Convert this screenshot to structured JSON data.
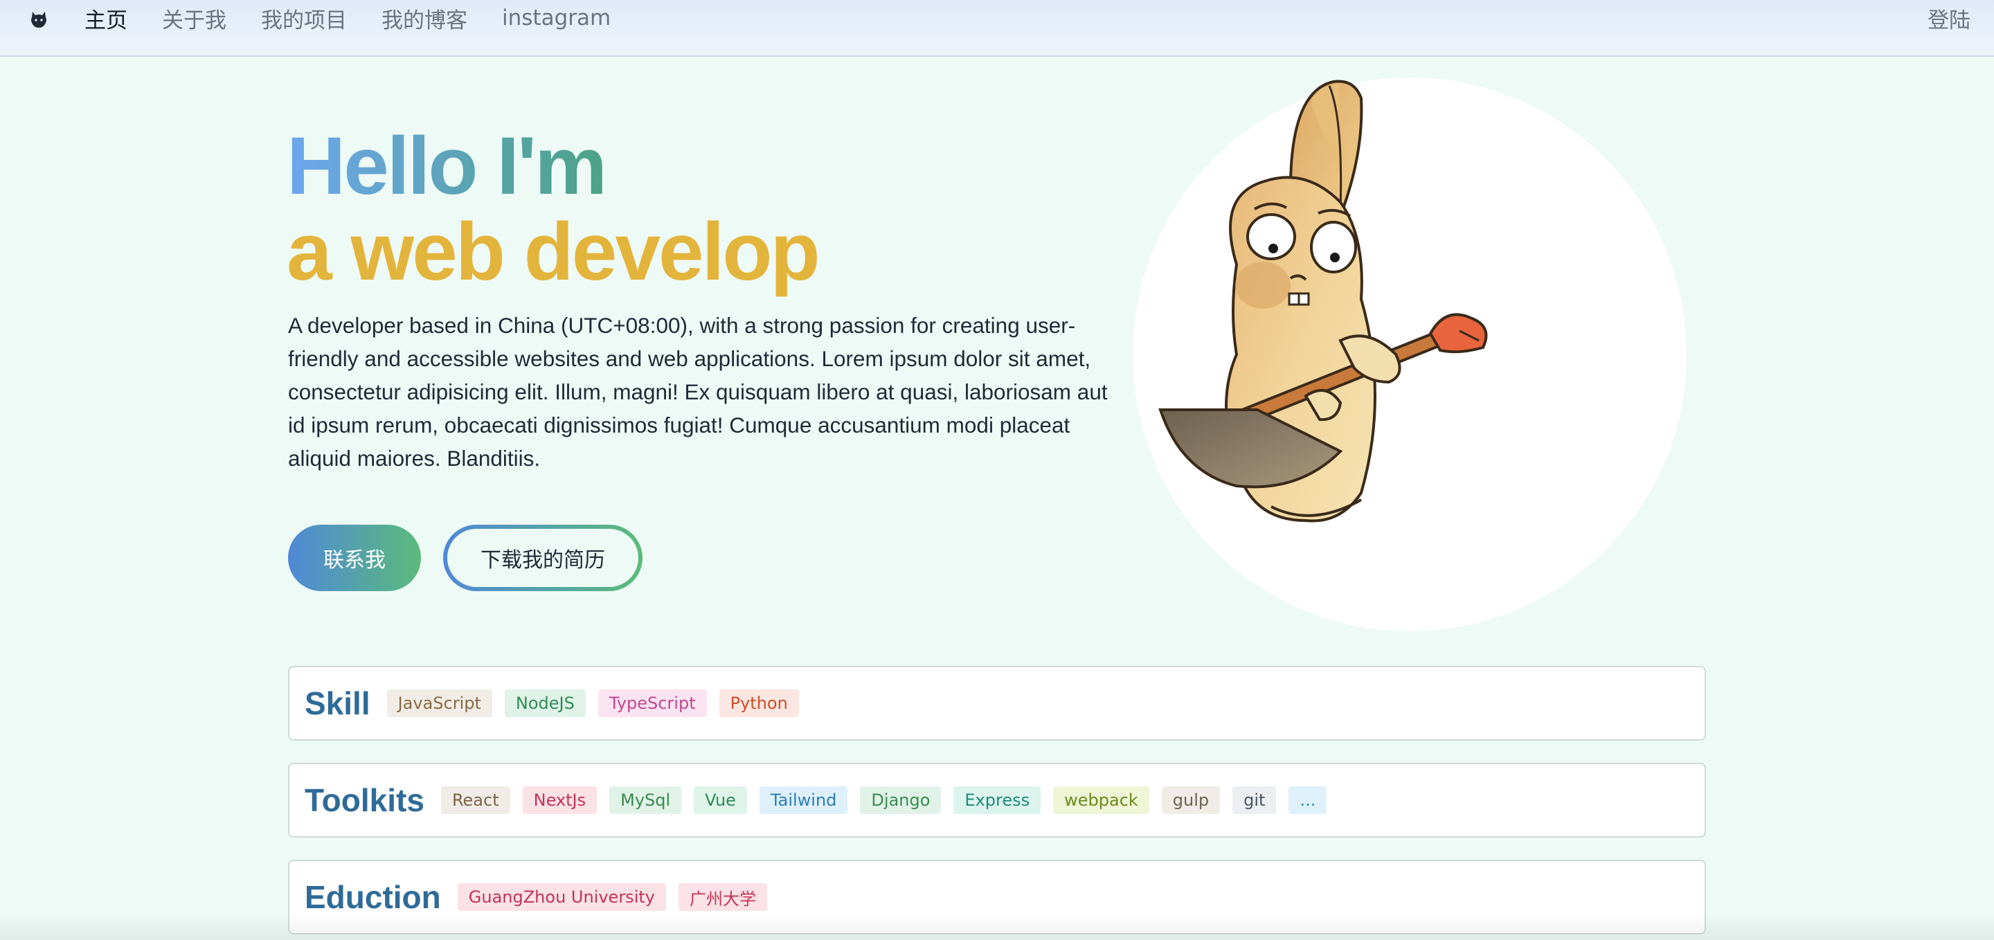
{
  "nav": {
    "links": [
      "主页",
      "关于我",
      "我的项目",
      "我的博客",
      "instagram"
    ],
    "login": "登陆",
    "logo_icon": "github-cat-icon"
  },
  "hero": {
    "line1": "Hello I'm",
    "line2": "a web develop",
    "description": "A developer based in China (UTC+08:00), with a strong passion for creating user-friendly and accessible websites and web applications. Lorem ipsum dolor sit amet, consectetur adipisicing elit. Illum, magni! Ex quisquam libero at quasi, laboriosam aut id ipsum rerum, obcaecati dignissimos fugiat! Cumque accusantium modi placeat aliquid maiores. Blanditiis.",
    "contact_button": "联系我",
    "resume_button": "下载我的简历",
    "illustration": "rabbit-with-shovel-illustration"
  },
  "colors": {
    "background": "#eefaf5",
    "title_gradient_start": "#6ea6ee",
    "title_gradient_end": "#3f9e5a",
    "title_line2": "#e3b43c",
    "card_title": "#2f6b98",
    "button_gradient_start": "#4f88d8",
    "button_gradient_end": "#5bbb7a"
  },
  "cards": {
    "skill": {
      "title": "Skill",
      "tags": [
        {
          "label": "JavaScript",
          "bg": "#f1ede6",
          "fg": "#8a6a44"
        },
        {
          "label": "NodeJS",
          "bg": "#e1f3e8",
          "fg": "#2f8a55"
        },
        {
          "label": "TypeScript",
          "bg": "#fbe4f1",
          "fg": "#c0478e"
        },
        {
          "label": "Python",
          "bg": "#fbe6e1",
          "fg": "#c8502c"
        }
      ]
    },
    "toolkits": {
      "title": "Toolkits",
      "tags": [
        {
          "label": "React",
          "bg": "#f1ede6",
          "fg": "#7a6547"
        },
        {
          "label": "NextJs",
          "bg": "#fbe2e6",
          "fg": "#c43356"
        },
        {
          "label": "MySql",
          "bg": "#e1f3e8",
          "fg": "#3a8a4f"
        },
        {
          "label": "Vue",
          "bg": "#e0f4ea",
          "fg": "#2f8a55"
        },
        {
          "label": "Tailwind",
          "bg": "#dff0fa",
          "fg": "#2a7fb4"
        },
        {
          "label": "Django",
          "bg": "#e1f3e8",
          "fg": "#3a8a4f"
        },
        {
          "label": "Express",
          "bg": "#dcf3ee",
          "fg": "#1f8a78"
        },
        {
          "label": "webpack",
          "bg": "#eef6d6",
          "fg": "#6b8a1f"
        },
        {
          "label": "gulp",
          "bg": "#efede6",
          "fg": "#6b6250"
        },
        {
          "label": "git",
          "bg": "#eceef1",
          "fg": "#4b5563"
        },
        {
          "label": "...",
          "bg": "#dff2fb",
          "fg": "#2a8ab4"
        }
      ]
    },
    "education": {
      "title": "Eduction",
      "tags": [
        {
          "label": "GuangZhou University",
          "bg": "#fbe2e6",
          "fg": "#c43356"
        },
        {
          "label": "广州大学",
          "bg": "#fbe2e6",
          "fg": "#c43356"
        }
      ]
    }
  }
}
